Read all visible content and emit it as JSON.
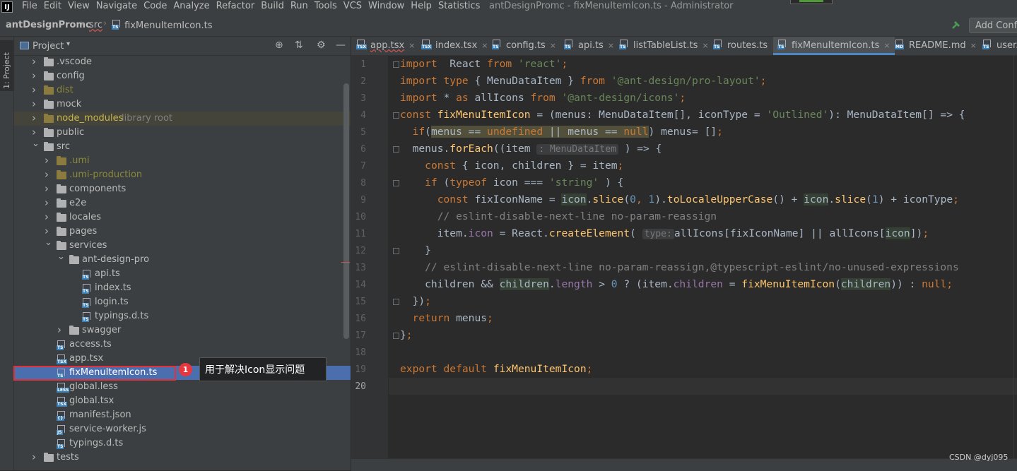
{
  "menu": {
    "app_icon": "IJ",
    "items": [
      "File",
      "Edit",
      "View",
      "Navigate",
      "Code",
      "Analyze",
      "Refactor",
      "Build",
      "Run",
      "Tools",
      "VCS",
      "Window",
      "Help",
      "Statistics"
    ],
    "window_title": "antDesignPromc - fixMenuItemIcon.ts - Administrator"
  },
  "navbar": {
    "project": "antDesignPromc",
    "folder": "src",
    "file": "fixMenuItemIcon.ts",
    "add_config": "Add Configuration..."
  },
  "left_strip": {
    "tab_label": "1: Project"
  },
  "project_panel": {
    "title": "Project",
    "tree": [
      {
        "label": ".vscode",
        "depth": 0,
        "kind": "folder",
        "state": "collapsed"
      },
      {
        "label": "config",
        "depth": 0,
        "kind": "folder",
        "state": "collapsed"
      },
      {
        "label": "dist",
        "depth": 0,
        "kind": "folder",
        "state": "collapsed",
        "tone": "excluded"
      },
      {
        "label": "mock",
        "depth": 0,
        "kind": "folder",
        "state": "collapsed"
      },
      {
        "label": "node_modules",
        "suffix": "library root",
        "depth": 0,
        "kind": "folder",
        "state": "collapsed",
        "tone": "library"
      },
      {
        "label": "public",
        "depth": 0,
        "kind": "folder",
        "state": "collapsed"
      },
      {
        "label": "src",
        "depth": 0,
        "kind": "folder",
        "state": "expanded"
      },
      {
        "label": ".umi",
        "depth": 1,
        "kind": "folder",
        "state": "collapsed",
        "tone": "excluded"
      },
      {
        "label": ".umi-production",
        "depth": 1,
        "kind": "folder",
        "state": "collapsed",
        "tone": "excluded"
      },
      {
        "label": "components",
        "depth": 1,
        "kind": "folder",
        "state": "collapsed"
      },
      {
        "label": "e2e",
        "depth": 1,
        "kind": "folder",
        "state": "collapsed"
      },
      {
        "label": "locales",
        "depth": 1,
        "kind": "folder",
        "state": "collapsed"
      },
      {
        "label": "pages",
        "depth": 1,
        "kind": "folder",
        "state": "collapsed"
      },
      {
        "label": "services",
        "depth": 1,
        "kind": "folder",
        "state": "expanded"
      },
      {
        "label": "ant-design-pro",
        "depth": 2,
        "kind": "folder",
        "state": "expanded"
      },
      {
        "label": "api.ts",
        "depth": 3,
        "kind": "ts"
      },
      {
        "label": "index.ts",
        "depth": 3,
        "kind": "ts"
      },
      {
        "label": "login.ts",
        "depth": 3,
        "kind": "ts"
      },
      {
        "label": "typings.d.ts",
        "depth": 3,
        "kind": "ts"
      },
      {
        "label": "swagger",
        "depth": 2,
        "kind": "folder",
        "state": "collapsed"
      },
      {
        "label": "access.ts",
        "depth": 1,
        "kind": "ts"
      },
      {
        "label": "app.tsx",
        "depth": 1,
        "kind": "tsx"
      },
      {
        "label": "fixMenuItemIcon.ts",
        "depth": 1,
        "kind": "ts",
        "selected": true
      },
      {
        "label": "global.less",
        "depth": 1,
        "kind": "less"
      },
      {
        "label": "global.tsx",
        "depth": 1,
        "kind": "tsx"
      },
      {
        "label": "manifest.json",
        "depth": 1,
        "kind": "json"
      },
      {
        "label": "service-worker.js",
        "depth": 1,
        "kind": "js"
      },
      {
        "label": "typings.d.ts",
        "depth": 1,
        "kind": "ts"
      },
      {
        "label": "tests",
        "depth": 0,
        "kind": "folder",
        "state": "collapsed"
      }
    ]
  },
  "annotation": {
    "badge": "1",
    "callout": "用于解决Icon显示问题"
  },
  "tabs": [
    {
      "label": "app.tsx",
      "icon": "tsx"
    },
    {
      "label": "index.tsx",
      "icon": "tsx"
    },
    {
      "label": "config.ts",
      "icon": "ts"
    },
    {
      "label": "api.ts",
      "icon": "ts"
    },
    {
      "label": "listTableList.ts",
      "icon": "ts"
    },
    {
      "label": "routes.ts",
      "icon": "ts"
    },
    {
      "label": "fixMenuItemIcon.ts",
      "icon": "ts",
      "active": true
    },
    {
      "label": "README.md",
      "icon": "md"
    },
    {
      "label": "user.ts",
      "icon": "ts"
    }
  ],
  "editor": {
    "current_line": 20,
    "lines": [
      [
        [
          "kw",
          "import"
        ],
        [
          "",
          "  React "
        ],
        [
          "kw",
          "from"
        ],
        [
          "",
          " "
        ],
        [
          "str",
          "'react'"
        ],
        [
          "kw",
          ";"
        ]
      ],
      [
        [
          "kw",
          "import"
        ],
        [
          "",
          " "
        ],
        [
          "kw",
          "type"
        ],
        [
          "",
          " { MenuDataItem } "
        ],
        [
          "kw",
          "from"
        ],
        [
          "",
          " "
        ],
        [
          "str",
          "'@ant-design/pro-layout'"
        ],
        [
          "kw",
          ";"
        ]
      ],
      [
        [
          "kw",
          "import"
        ],
        [
          "",
          " * "
        ],
        [
          "kw",
          "as"
        ],
        [
          "",
          " allIcons "
        ],
        [
          "kw",
          "from"
        ],
        [
          "",
          " "
        ],
        [
          "str",
          "'@ant-design/icons'"
        ],
        [
          "kw",
          ";"
        ]
      ],
      [
        [
          "kw",
          "const"
        ],
        [
          "",
          " "
        ],
        [
          "fn",
          "fixMenuItemIcon"
        ],
        [
          "",
          " = (menus: MenuDataItem[], iconType = "
        ],
        [
          "str",
          "'Outlined'"
        ],
        [
          "",
          "): MenuDataItem[] => {"
        ]
      ],
      [
        [
          "",
          "  "
        ],
        [
          "kw",
          "if"
        ],
        [
          "",
          "("
        ],
        [
          "hlw",
          "menus == "
        ],
        [
          "kwhlw",
          "undefined"
        ],
        [
          "hlw",
          " || menus == "
        ],
        [
          "kwhlw",
          "null"
        ],
        [
          "",
          ") menus= []"
        ],
        [
          "kw",
          ";"
        ]
      ],
      [
        [
          "",
          "  menus."
        ],
        [
          "fn",
          "forEach"
        ],
        [
          "",
          "((item "
        ],
        [
          "hint",
          ": MenuDataItem"
        ],
        [
          "",
          " ) => {"
        ]
      ],
      [
        [
          "",
          "    "
        ],
        [
          "kw",
          "const"
        ],
        [
          "",
          " { icon, children } = item"
        ],
        [
          "kw",
          ";"
        ]
      ],
      [
        [
          "",
          "    "
        ],
        [
          "kw",
          "if"
        ],
        [
          "",
          " ("
        ],
        [
          "kw",
          "typeof"
        ],
        [
          "",
          " icon === "
        ],
        [
          "str",
          "'string'"
        ],
        [
          "",
          " ) {"
        ]
      ],
      [
        [
          "",
          "      "
        ],
        [
          "kw",
          "const"
        ],
        [
          "",
          " fixIconName = "
        ],
        [
          "hl",
          "icon"
        ],
        [
          "",
          "."
        ],
        [
          "fn",
          "slice"
        ],
        [
          "",
          "("
        ],
        [
          "num",
          "0"
        ],
        [
          "kw",
          ","
        ],
        [
          "",
          " "
        ],
        [
          "num",
          "1"
        ],
        [
          "",
          ")."
        ],
        [
          "fn",
          "toLocaleUpperCase"
        ],
        [
          "",
          "() + "
        ],
        [
          "hl",
          "icon"
        ],
        [
          "",
          "."
        ],
        [
          "fn",
          "slice"
        ],
        [
          "",
          "("
        ],
        [
          "num",
          "1"
        ],
        [
          "",
          ") + iconType"
        ],
        [
          "kw",
          ";"
        ]
      ],
      [
        [
          "cm",
          "      // eslint-disable-next-line no-param-reassign"
        ]
      ],
      [
        [
          "",
          "      item."
        ],
        [
          "prop",
          "icon"
        ],
        [
          "",
          " = React."
        ],
        [
          "fn",
          "createElement"
        ],
        [
          "",
          "( "
        ],
        [
          "hint",
          "type:"
        ],
        [
          "",
          "allIcons[fixIconName] || allIcons["
        ],
        [
          "hl",
          "icon"
        ],
        [
          "",
          "])"
        ],
        [
          "kw",
          ";"
        ]
      ],
      [
        [
          "",
          "    }"
        ]
      ],
      [
        [
          "cm",
          "    // eslint-disable-next-line no-param-reassign,@typescript-eslint/no-unused-expressions"
        ]
      ],
      [
        [
          "",
          "    children && "
        ],
        [
          "hl",
          "children"
        ],
        [
          "",
          "."
        ],
        [
          "prop",
          "length"
        ],
        [
          "",
          " > "
        ],
        [
          "num",
          "0"
        ],
        [
          "",
          " ? (item."
        ],
        [
          "prop",
          "children"
        ],
        [
          "",
          " = "
        ],
        [
          "fn",
          "fixMenuItemIcon"
        ],
        [
          "",
          "("
        ],
        [
          "hl",
          "children"
        ],
        [
          "",
          ")) : "
        ],
        [
          "kw",
          "null;"
        ]
      ],
      [
        [
          "",
          "  })"
        ],
        [
          "kw",
          ";"
        ]
      ],
      [
        [
          "",
          "  "
        ],
        [
          "kw",
          "return"
        ],
        [
          "",
          " menus"
        ],
        [
          "kw",
          ";"
        ]
      ],
      [
        [
          "",
          "}"
        ],
        [
          "kw",
          ";"
        ]
      ],
      [
        [
          "",
          ""
        ]
      ],
      [
        [
          "kw",
          "export default"
        ],
        [
          "",
          " "
        ],
        [
          "fn",
          "fixMenuItemIcon"
        ],
        [
          "kw",
          ";"
        ]
      ],
      [
        [
          "",
          ""
        ]
      ]
    ]
  },
  "watermark": "CSDN @dyj095"
}
